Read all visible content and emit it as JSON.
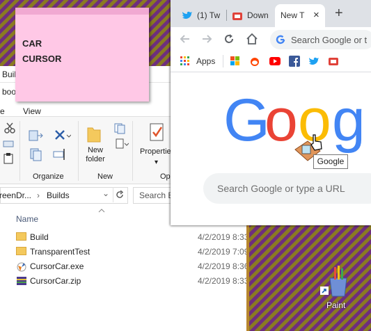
{
  "sticky_note": {
    "line1": "CAR",
    "line2": "CURSOR"
  },
  "explorer": {
    "title_partial": "Buil",
    "tab_partial": "boo",
    "menu": {
      "first_partial": "e",
      "view": "View"
    },
    "ribbon": {
      "groups": {
        "organize": "Organize",
        "new": "New",
        "open_partial": "Op"
      },
      "new_folder_line1": "New",
      "new_folder_line2": "folder",
      "properties": "Propertie"
    },
    "address": {
      "crumb1": "reenDr...",
      "sep": "›",
      "crumb2": "Builds",
      "chevron": "⌄",
      "search_placeholder": "Search B"
    },
    "column_header": "Name",
    "files": [
      {
        "name": "Build",
        "date": "4/2/2019 8:33",
        "icon": "folder-icon"
      },
      {
        "name": "TransparentTest",
        "date": "4/2/2019 7:09",
        "icon": "folder-icon"
      },
      {
        "name": "CursorCar.exe",
        "date": "4/2/2019 8:36",
        "icon": "exe-icon"
      },
      {
        "name": "CursorCar.zip",
        "date": "4/2/2019 8:33",
        "icon": "zip-icon"
      }
    ]
  },
  "browser": {
    "tabs": [
      {
        "label": "(1) Tw",
        "icon": "twitter-icon"
      },
      {
        "label": "Down",
        "icon": "game-icon"
      },
      {
        "label": "New T",
        "icon": ""
      }
    ],
    "new_tab": "+",
    "close_tab": "×",
    "omnibox_placeholder": "Search Google or t",
    "apps_label": "Apps",
    "google_logo": [
      "G",
      "o",
      "o",
      "g"
    ],
    "search_placeholder": "Search Google or type a URL",
    "tooltip": "Google"
  },
  "desktop": {
    "paint_label": "Paint"
  },
  "colors": {
    "google_blue": "#4285f4",
    "google_red": "#ea4335",
    "google_yellow": "#fbbc05",
    "sticky": "#ffc8e6",
    "tab_bg": "#dee1e6"
  }
}
